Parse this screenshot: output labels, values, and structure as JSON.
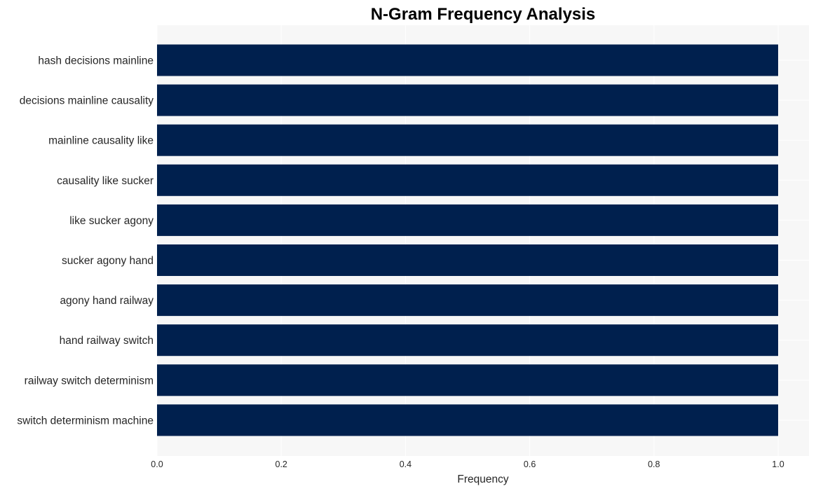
{
  "chart_data": {
    "type": "bar",
    "orientation": "horizontal",
    "title": "N-Gram Frequency Analysis",
    "xlabel": "Frequency",
    "ylabel": "",
    "categories": [
      "hash decisions mainline",
      "decisions mainline causality",
      "mainline causality like",
      "causality like sucker",
      "like sucker agony",
      "sucker agony hand",
      "agony hand railway",
      "hand railway switch",
      "railway switch determinism",
      "switch determinism machine"
    ],
    "values": [
      1,
      1,
      1,
      1,
      1,
      1,
      1,
      1,
      1,
      1
    ],
    "xlim": [
      0,
      1.05
    ],
    "xticks": [
      0.0,
      0.2,
      0.4,
      0.6,
      0.8,
      1.0
    ],
    "xtick_labels": [
      "0.0",
      "0.2",
      "0.4",
      "0.6",
      "0.8",
      "1.0"
    ],
    "grid": true,
    "bar_color": "#00204e",
    "plot_background": "#f7f7f7",
    "grid_color": "#ffffff"
  }
}
